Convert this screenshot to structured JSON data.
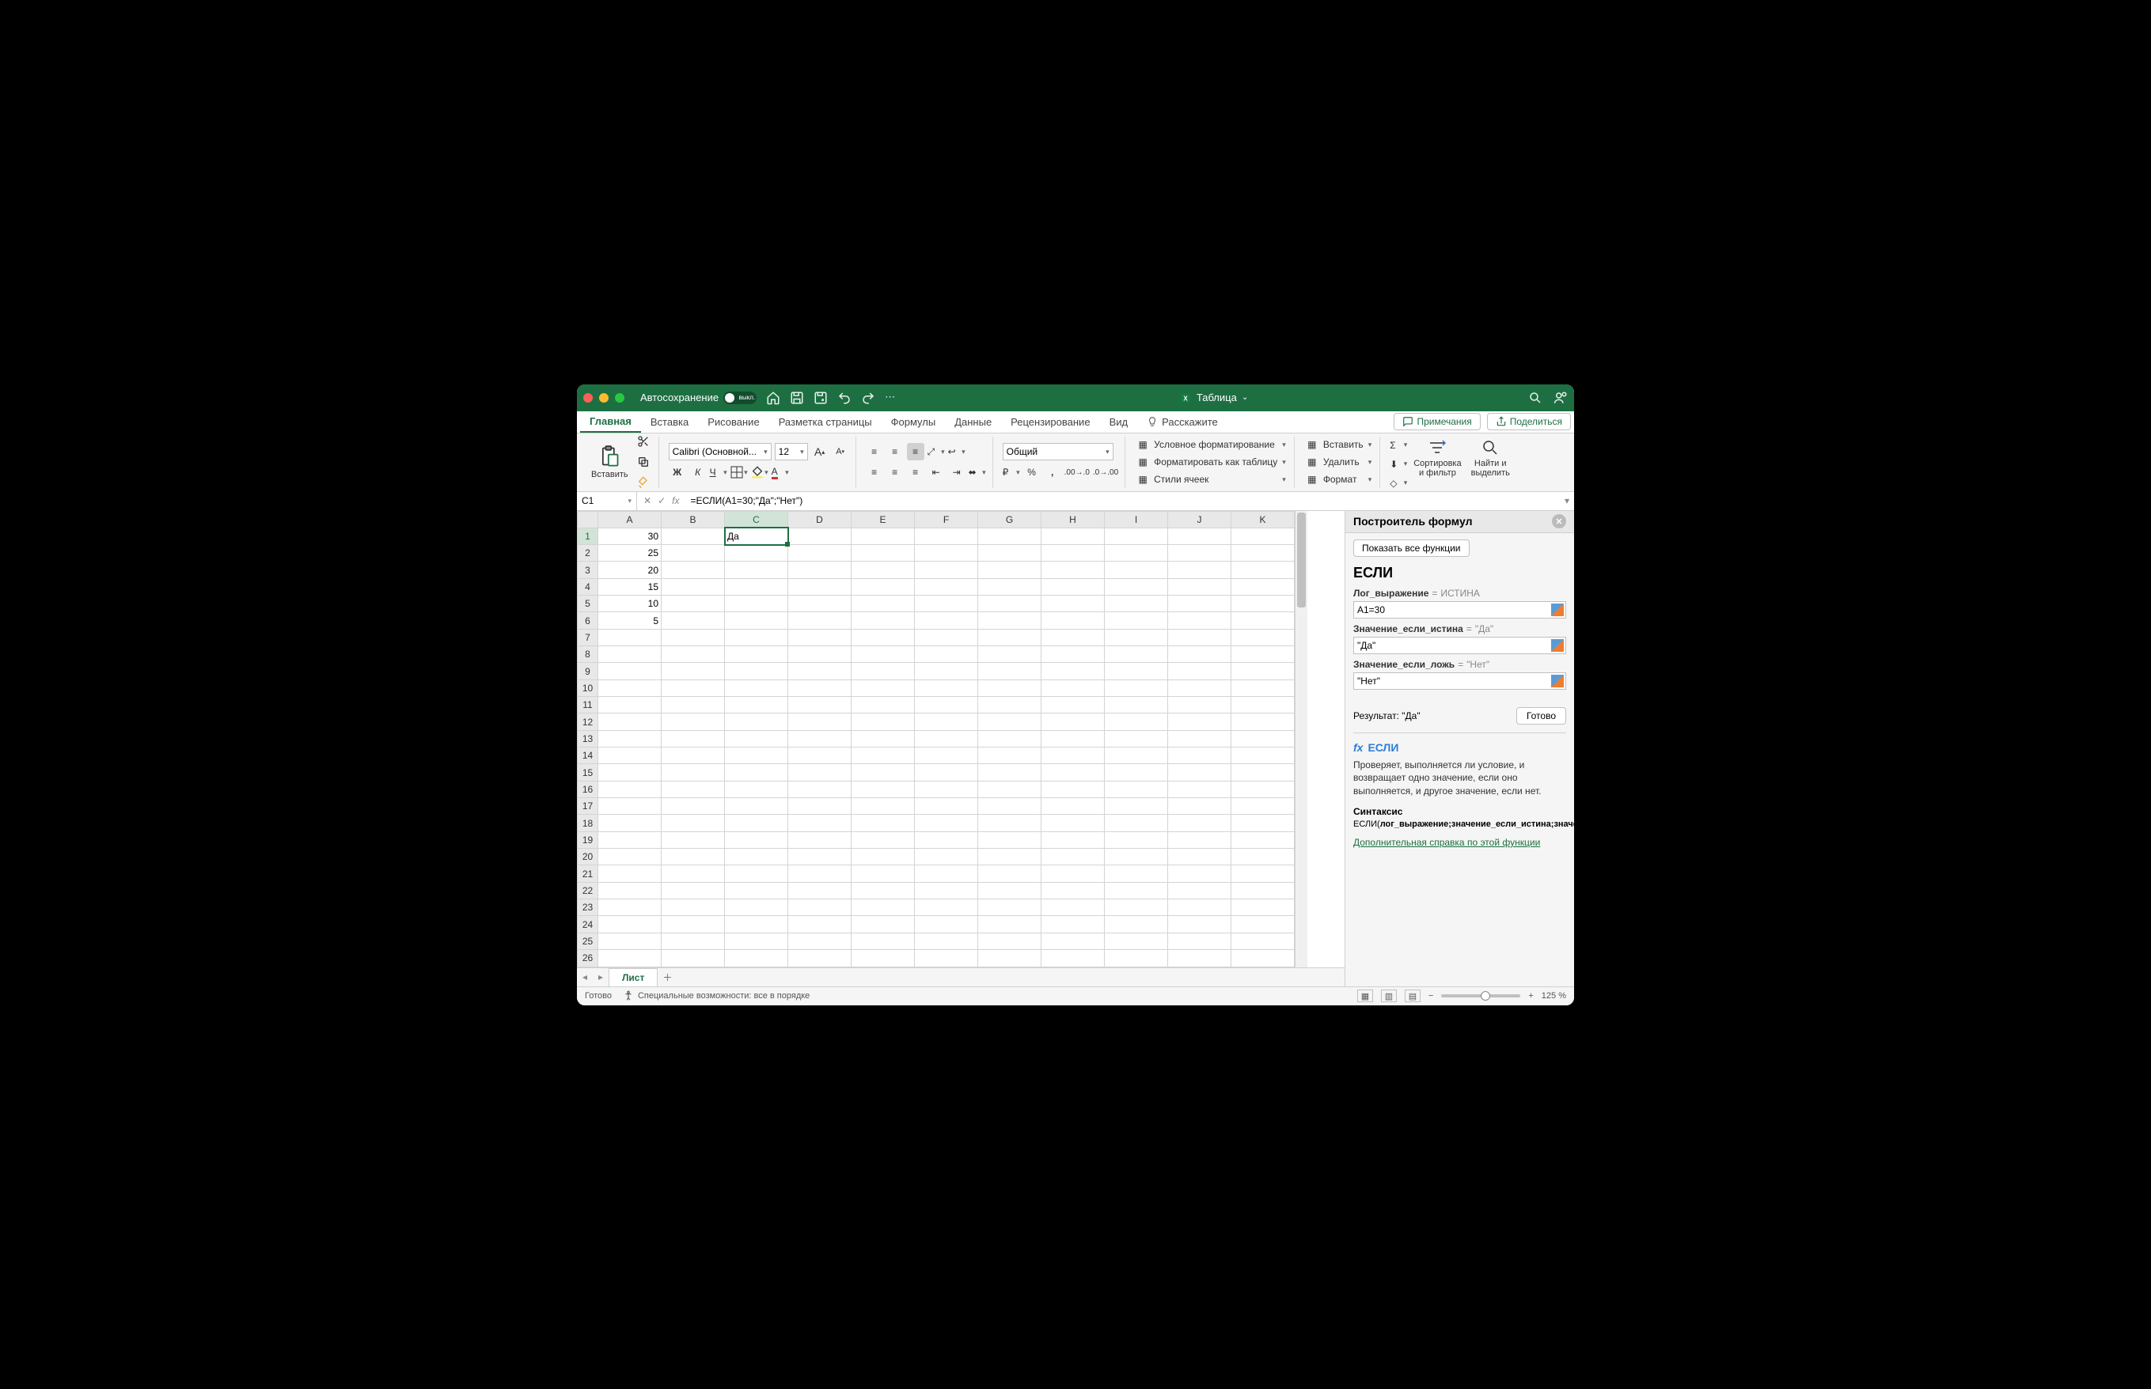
{
  "titlebar": {
    "autosave_label": "Автосохранение",
    "autosave_toggle": "выкл.",
    "doc_title": "Таблица"
  },
  "tabs": {
    "home": "Главная",
    "insert": "Вставка",
    "draw": "Рисование",
    "layout": "Разметка страницы",
    "formulas": "Формулы",
    "data": "Данные",
    "review": "Рецензирование",
    "view": "Вид",
    "tell": "Расскажите",
    "comments": "Примечания",
    "share": "Поделиться"
  },
  "ribbon": {
    "paste": "Вставить",
    "font_name": "Calibri (Основной...",
    "font_size": "12",
    "number_format": "Общий",
    "cond_fmt": "Условное форматирование",
    "as_table": "Форматировать как таблицу",
    "cell_styles": "Стили ячеек",
    "insert_cells": "Вставить",
    "delete_cells": "Удалить",
    "format_cells": "Формат",
    "sort_filter": "Сортировка\nи фильтр",
    "find_select": "Найти и\nвыделить"
  },
  "formula_bar": {
    "cell_ref": "C1",
    "formula": "=ЕСЛИ(A1=30;\"Да\";\"Нет\")"
  },
  "columns": [
    "A",
    "B",
    "C",
    "D",
    "E",
    "F",
    "G",
    "H",
    "I",
    "J",
    "K"
  ],
  "rows": 26,
  "cells": {
    "A1": "30",
    "A2": "25",
    "A3": "20",
    "A4": "15",
    "A5": "10",
    "A6": "5",
    "C1": "Да"
  },
  "selected_cell": "C1",
  "panel": {
    "title": "Построитель формул",
    "show_all": "Показать все функции",
    "fn": "ЕСЛИ",
    "args": [
      {
        "label": "Лог_выражение",
        "preview": "ИСТИНА",
        "value": "A1=30"
      },
      {
        "label": "Значение_если_истина",
        "preview": "\"Да\"",
        "value": "\"Да\""
      },
      {
        "label": "Значение_если_ложь",
        "preview": "\"Нет\"",
        "value": "\"Нет\""
      }
    ],
    "result_label": "Результат:",
    "result_value": "\"Да\"",
    "done": "Готово",
    "help_fn": "ЕСЛИ",
    "help_desc": "Проверяет, выполняется ли условие, и возвращает одно значение, если оно выполняется, и другое значение, если нет.",
    "syntax_label": "Синтаксис",
    "syntax_text": "ЕСЛИ(лог_выражение;значение_если_истина;значение_если_ложь)",
    "help_link": "Дополнительная справка по этой функции"
  },
  "sheet_tab": "Лист",
  "status": {
    "ready": "Готово",
    "a11y": "Специальные возможности: все в порядке",
    "zoom": "125 %"
  }
}
